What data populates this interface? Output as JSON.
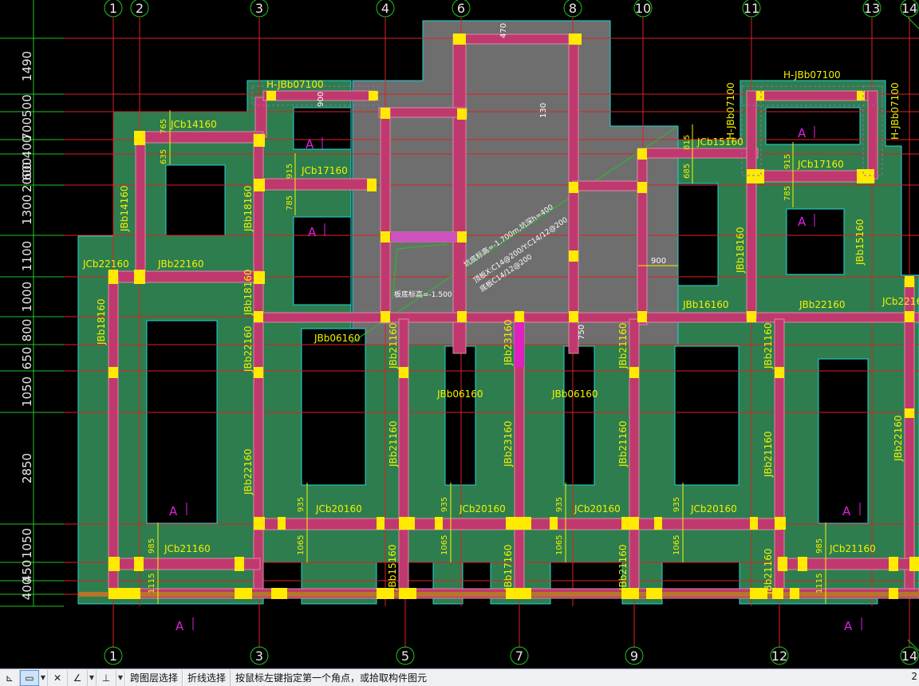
{
  "axes": {
    "top": [
      "1",
      "2",
      "3",
      "4",
      "6",
      "8",
      "10",
      "11",
      "13",
      "14"
    ],
    "bottom": [
      "1",
      "3",
      "5",
      "7",
      "9",
      "12",
      "14"
    ],
    "left_dims": [
      "1490",
      "700500",
      "400",
      "600",
      "2000",
      "1300",
      "1100",
      "1000",
      "800",
      "650",
      "1050",
      "2850",
      "1050",
      "450",
      "400"
    ]
  },
  "beams": {
    "h_top_left": "H-JBb07100",
    "h_top_right": "H-JBb07100",
    "h_vert_a": "H-JBb07100",
    "h_vert_b": "H-JBb07100",
    "jcb14160": "JCb14160",
    "jbb14160": "JBb14160",
    "jcb17160_l": "JCb17160",
    "jbb18160_a": "JBb18160",
    "jcb22160": "JCb22160",
    "jbb22160_h": "JBb22160",
    "jbb18160_b": "JBb18160",
    "jbb18160_c": "JBb18160",
    "jbb22160_v": "JBb22160",
    "jbb22160_v2": "JBb22160",
    "jbb06160_a": "JBb06160",
    "jbb21160_a": "JBb21160",
    "jbb21160_b": "JBb21160",
    "jbb23160_a": "JBb23160",
    "jbb23160_b": "JBb23160",
    "jbb06160_b": "JBb06160",
    "jbb06160_c": "JBb06160",
    "jbb21160_c": "JBb21160",
    "jbb21160_d": "JBb21160",
    "jbb21160_e": "JBb21160",
    "jbb21160_f": "JBb21160",
    "jbb21160_g": "JBb21160",
    "jcb15160": "JCb15160",
    "jcb17160_r": "JCb17160",
    "jbb18160_r": "JBb18160",
    "jbb15160": "JBb15160",
    "jbb16160": "JBb16160",
    "jbb22160_r": "JBb22160",
    "jcb22160_r": "JCb22160",
    "jbb22160_rv": "JBb22160",
    "jcb20160_1": "JCb20160",
    "jcb20160_2": "JCb20160",
    "jcb20160_3": "JCb20160",
    "jcb20160_4": "JCb20160",
    "jcb21160_l": "JCb21160",
    "jcb21160_r": "JCb21160",
    "jbb15160_b": "JBb15160",
    "jbb17160": "JBb17160",
    "jbb21160_h": "JBb21160",
    "jbb21160_i": "JBb21160"
  },
  "dims": {
    "d470": "470",
    "d900a": "900",
    "d130": "130",
    "d765": "765",
    "d635": "635",
    "d915a": "915",
    "d785a": "785",
    "d815": "815",
    "d685": "685",
    "d915b": "915",
    "d785b": "785",
    "d900b": "900",
    "d750": "750",
    "d935": "935",
    "d1065": "1065",
    "d985": "985",
    "d1115": "1115"
  },
  "annotations": {
    "slope_1": "坑底标高=-1.700m,坑深h=400",
    "slope_2": "顶板X:C14@200/Y:C14/12@200",
    "slope_3": "底板C14/12@200",
    "pit_elev": "板底标高=-1.500"
  },
  "zone_label": "A",
  "statusbar": {
    "btn1": "跨图层选择",
    "btn2": "折线选择",
    "prompt": "按鼠标左键指定第一个角点，或拾取构件图元",
    "right": "2"
  },
  "colors": {
    "green_slab": "#2e7d4f",
    "gray_pit": "#6e6e6e",
    "beam_fill": "#c0396e",
    "beam_edge": "#d98aa6",
    "column": "#ffea00",
    "grid_red": "#e02020",
    "grid_green": "#22c422",
    "label_yellow": "#f2f200",
    "label_magenta": "#e020e0",
    "outline_cyan": "#23d7d7",
    "bg": "#000000"
  }
}
